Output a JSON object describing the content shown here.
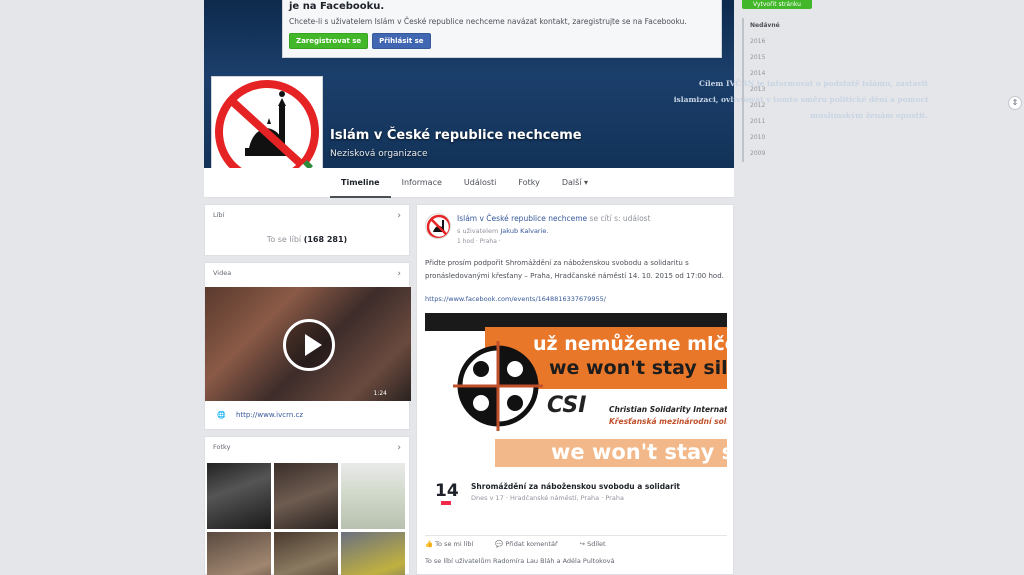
{
  "login_box": {
    "title": "je na Facebooku.",
    "text": "Chcete-li s uživatelem Islám v České republice nechceme navázat kontakt, zaregistrujte se na Facebooku.",
    "register_label": "Zaregistrovat se",
    "login_label": "Přihlásit se"
  },
  "right_button_label": "Vytvořit stránku",
  "cover": {
    "text": "Cílem IVČRN je informovat o podstatě islámu, zastavit islamizaci, ovlivňovat v tomto směru politické dění a pomoci muslimským ženám opustit.",
    "page_title": "Islám v České republice nechceme",
    "page_category": "Nezisková organizace"
  },
  "tabs": [
    "Timeline",
    "Informace",
    "Události",
    "Fotky",
    "Další ▾"
  ],
  "years": [
    "Nedávné",
    "2016",
    "2015",
    "2014",
    "2013",
    "2012",
    "2011",
    "2010",
    "2009"
  ],
  "like_card": {
    "header": "Líbí",
    "likes_prefix": "To se líbí",
    "likes_count": "(168 281)"
  },
  "video_card": {
    "header": "Videa",
    "duration": "1:24",
    "link_label": "http://www.ivcrn.cz"
  },
  "photos_card": {
    "header": "Fotky"
  },
  "post": {
    "author": "Islám v České republice nechceme",
    "author_suffix": "se cítí s: událost",
    "with_prefix": "s uživatelem",
    "with_names": "Jakub Kalvarie.",
    "time": "1 hod · Praha ·",
    "text": "Přidte prosím podpořit Shromáždění za náboženskou svobodu a solidaritu s pronásledovanými křesťany – Praha, Hradčanské náměstí 14. 10. 2015 od 17:00 hod.",
    "url": "https://www.facebook.com/events/1648816337679955/",
    "banner": {
      "slogan_cz": "už nemůžeme mlčet",
      "slogan_en": "we won't stay silent",
      "logo": "CSI",
      "org_en": "Christian Solidarity International",
      "org_cz": "Křesťanská mezinárodní solidarita",
      "slogan_bottom": "we won't stay silent"
    },
    "event": {
      "day": "14",
      "title": "Shromáždění za náboženskou svobodu a solidarit",
      "subtitle": "Dnes v 17 · Hradčanské náměstí, Praha · Praha"
    },
    "actions": [
      "To se mi líbí",
      "Přidat komentář",
      "Sdílet"
    ],
    "likes_text": "To se líbí uživatelům Radomíra Lau Bláh a Adéla Pultoková"
  }
}
